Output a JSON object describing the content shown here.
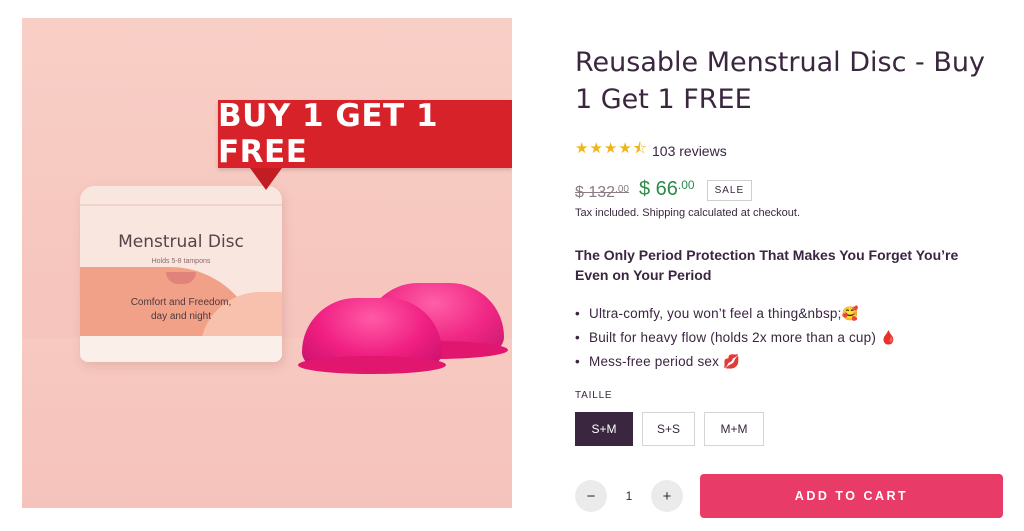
{
  "image": {
    "promo_banner": "BUY 1 GET 1 FREE",
    "tin_title": "Menstrual Disc",
    "tin_arc_text": "Holds 5-8 tampons",
    "tin_subtitle_line1": "Comfort and Freedom,",
    "tin_subtitle_line2": "day and night"
  },
  "product": {
    "title": "Reusable Menstrual Disc - Buy 1 Get 1 FREE",
    "stars": "★★★★⯪",
    "star_icon": "half-star-rating-icon",
    "star_color": "#f1b51c",
    "review_count": "103 reviews",
    "old_price": "$ 132",
    "old_price_cents": ".00",
    "new_price": "$ 66",
    "new_price_cents": ".00",
    "sale_badge": "SALE",
    "tax_note": "Tax included. Shipping calculated at checkout.",
    "headline": "The Only Period Protection That Makes You Forget You’re Even on Your Period",
    "bullets": [
      "Ultra-comfy, you won’t feel a thing&nbsp;🥰",
      "Built for heavy flow (holds 2x more than a cup) 🩸",
      "Mess-free period sex 💋"
    ],
    "size_label": "TAILLE",
    "sizes": [
      "S+M",
      "S+S",
      "M+M"
    ],
    "selected_size": "S+M",
    "quantity": "1",
    "minus_symbol": "−",
    "plus_symbol": "+",
    "add_to_cart": "ADD TO CART",
    "accent_color": "#e83b67",
    "price_color": "#2f8b4a",
    "text_color": "#3b2640"
  }
}
